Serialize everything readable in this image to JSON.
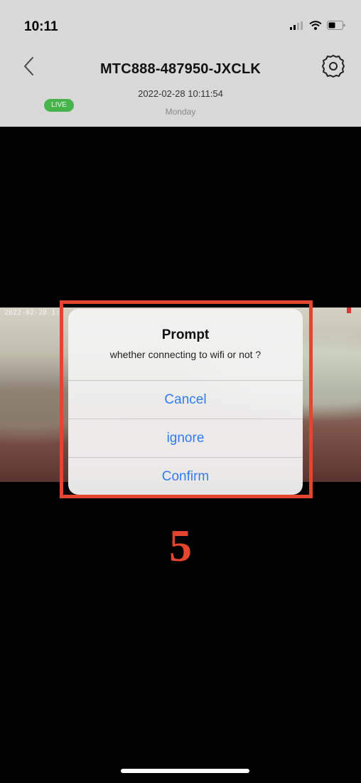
{
  "status_bar": {
    "time": "10:11"
  },
  "header": {
    "device_name": "MTC888-487950-JXCLK",
    "datetime": "2022-02-28 10:11:54",
    "weekday": "Monday",
    "live_badge": "LIVE"
  },
  "video": {
    "osd_text": "2022-02-28 1:1"
  },
  "dialog": {
    "title": "Prompt",
    "message": "whether connecting to wifi or not ?",
    "buttons": [
      "Cancel",
      "ignore",
      "Confirm"
    ]
  },
  "annotation": {
    "step": "5"
  },
  "colors": {
    "header_bg": "#d9d9d9",
    "live_green": "#45b54b",
    "ios_blue": "#2f7cf6",
    "highlight_red": "#e4452f"
  }
}
